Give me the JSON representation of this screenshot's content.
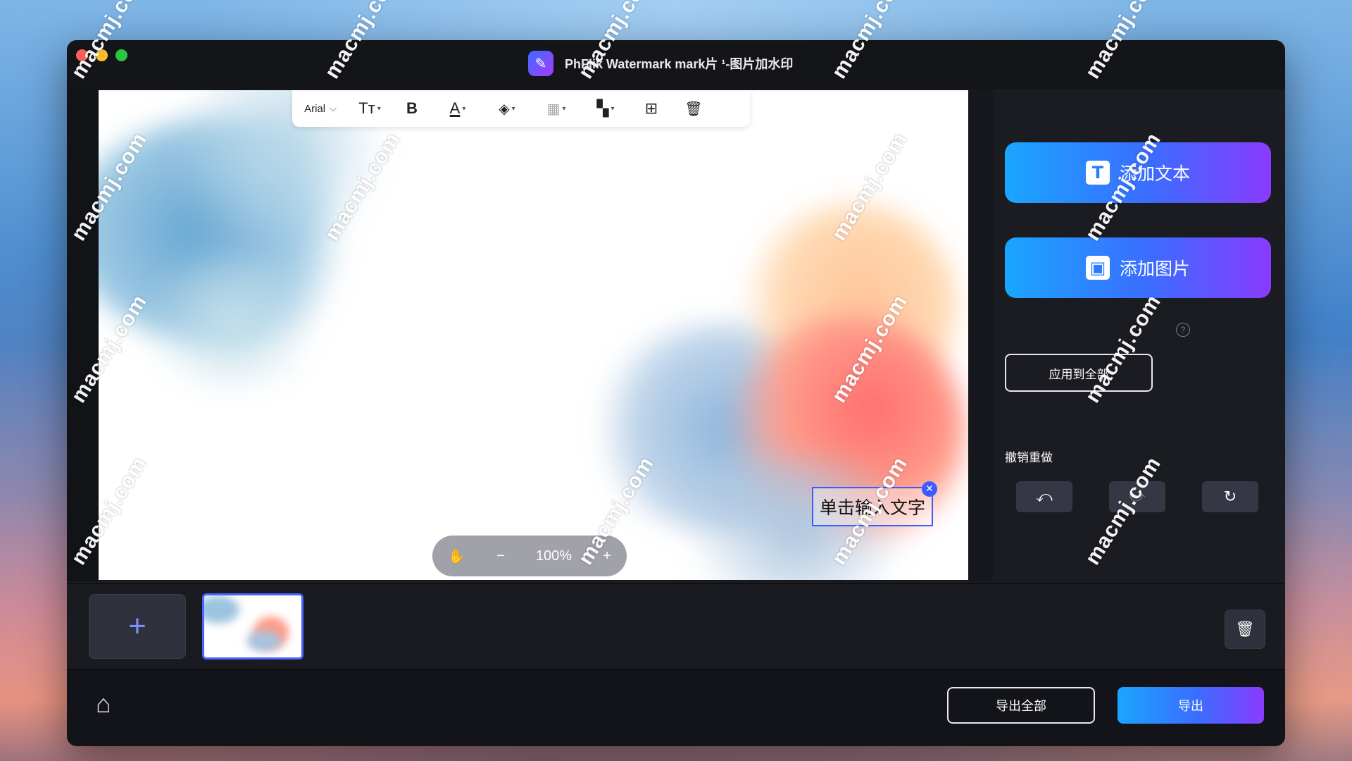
{
  "window": {
    "title": "PhFlik Watermark mark片 ¹-图片加水印"
  },
  "toolbar": {
    "font_name": "Arial",
    "font_size_icon": "text-size-icon",
    "bold_label": "B",
    "text_color_icon": "font-color-icon",
    "fill_icon": "fill-color-icon",
    "opacity_icon": "transparency-icon",
    "tile_icon": "tile-grid-icon",
    "duplicate_icon": "duplicate-icon",
    "delete_icon": "trash-icon"
  },
  "canvas": {
    "zoom_level": "100%",
    "text_watermark": "单击输入文字"
  },
  "panel": {
    "add_text_label": "添加文本",
    "add_image_label": "添加图片",
    "apply_all_label": "应用到全部",
    "help_label": "?",
    "undo_redo_label": "撤销重做"
  },
  "footer": {
    "export_all_label": "导出全部",
    "export_label": "导出"
  },
  "overlay_watermark": "macmj.com",
  "colors": {
    "accent_start": "#1aa6ff",
    "accent_mid": "#3b6cff",
    "accent_end": "#8a3bff",
    "selection": "#4a62ff"
  }
}
